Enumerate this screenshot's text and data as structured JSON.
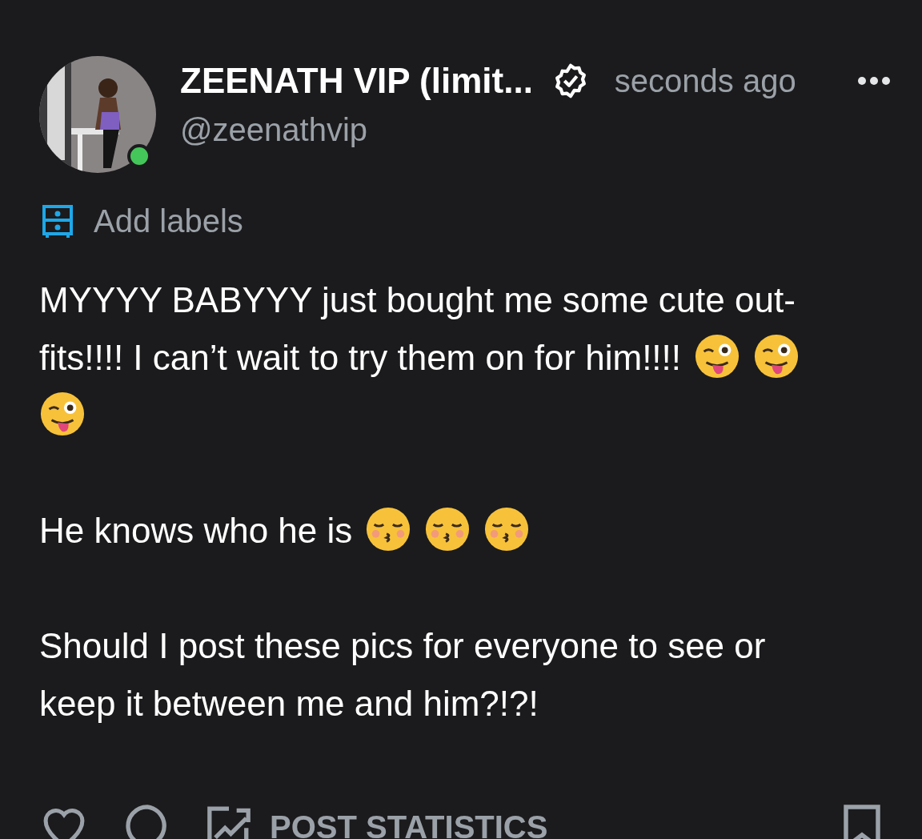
{
  "post": {
    "author": {
      "name": "ZEENATH VIP (limit...",
      "handle": "@zeenathvip",
      "verified": true,
      "online": true
    },
    "time": "seconds ago",
    "labels_link": "Add labels",
    "paragraphs": [
      [
        {
          "kind": "text",
          "text": "MYYYY BABYYY just bought me some cute out-"
        },
        {
          "kind": "text",
          "text": "fits!!!! I can’t wait to try them on for him!!!!"
        },
        {
          "kind": "wink"
        },
        {
          "kind": "wink"
        },
        {
          "kind": "wink"
        }
      ],
      [
        {
          "kind": "text",
          "text": "He knows who he is"
        },
        {
          "kind": "kiss"
        },
        {
          "kind": "kiss"
        },
        {
          "kind": "kiss"
        }
      ],
      [
        {
          "kind": "text",
          "text": "Should I post these pics for everyone to see or keep it between me and him?!?!"
        }
      ]
    ],
    "actions": {
      "statistics": "POST STATISTICS",
      "liked": false,
      "bookmarked": false
    }
  }
}
